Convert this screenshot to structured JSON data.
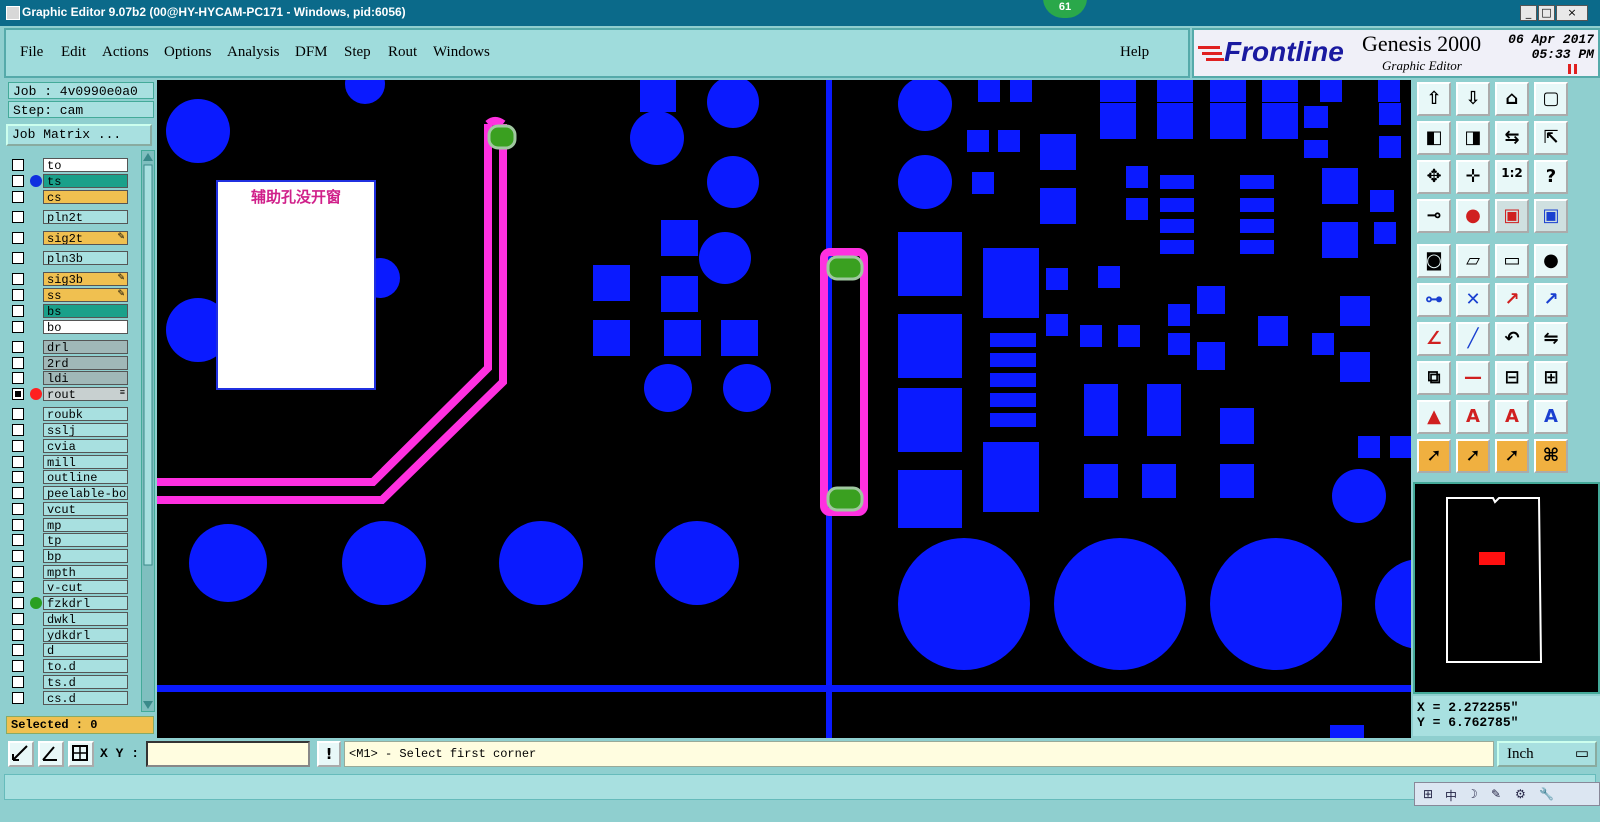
{
  "window": {
    "title": "Graphic Editor 9.07b2 (00@HY-HYCAM-PC171 - Windows, pid:6056)",
    "badge": "61",
    "controls": [
      "_",
      "□",
      "×"
    ]
  },
  "menu": {
    "items": [
      "File",
      "Edit",
      "Actions",
      "Options",
      "Analysis",
      "DFM",
      "Step",
      "Rout",
      "Windows"
    ],
    "help": "Help"
  },
  "brand": {
    "logo": "Frontline",
    "product": "Genesis 2000",
    "subtitle": "Graphic Editor",
    "date": "06 Apr 2017",
    "time": "05:33 PM"
  },
  "job": {
    "job_label": "Job : 4v0990e0a0",
    "step_label": "Step: cam",
    "matrix_button": "Job Matrix ..."
  },
  "layers": [
    {
      "name": "to",
      "bg": "#ffffff"
    },
    {
      "name": "ts",
      "bg": "#1aa08a",
      "dot": "#1030e0"
    },
    {
      "name": "cs",
      "bg": "#f0c050"
    },
    {
      "name": "pln2t",
      "bg": "#a8e0e0"
    },
    {
      "name": "sig2t",
      "bg": "#f0c050",
      "mark": "✎"
    },
    {
      "name": "pln3b",
      "bg": "#a8e0e0"
    },
    {
      "name": "sig3b",
      "bg": "#f0c050",
      "mark": "✎"
    },
    {
      "name": "ss",
      "bg": "#f0c050",
      "mark": "✎"
    },
    {
      "name": "bs",
      "bg": "#1aa08a"
    },
    {
      "name": "bo",
      "bg": "#ffffff"
    },
    {
      "name": "drl",
      "bg": "#a0b8b8"
    },
    {
      "name": "2rd",
      "bg": "#a0b8b8"
    },
    {
      "name": "ldi",
      "bg": "#a0b8b8"
    },
    {
      "name": "rout",
      "bg": "#c8d0d0",
      "dot": "#ff2020",
      "checked": true,
      "mark": "≡"
    },
    {
      "name": "roubk",
      "bg": "#a8e0e0"
    },
    {
      "name": "sslj",
      "bg": "#a8e0e0"
    },
    {
      "name": "cvia",
      "bg": "#a8e0e0"
    },
    {
      "name": "mill",
      "bg": "#a8e0e0"
    },
    {
      "name": "outline",
      "bg": "#a8e0e0"
    },
    {
      "name": "peelable-bot",
      "bg": "#a8e0e0"
    },
    {
      "name": "vcut",
      "bg": "#a8e0e0"
    },
    {
      "name": "mp",
      "bg": "#a8e0e0"
    },
    {
      "name": "tp",
      "bg": "#a8e0e0"
    },
    {
      "name": "bp",
      "bg": "#a8e0e0"
    },
    {
      "name": "mpth",
      "bg": "#a8e0e0"
    },
    {
      "name": "v-cut",
      "bg": "#a8e0e0"
    },
    {
      "name": "fzkdrl",
      "bg": "#a8e0e0",
      "dot": "#2aa020"
    },
    {
      "name": "dwkl",
      "bg": "#a8e0e0"
    },
    {
      "name": "ydkdrl",
      "bg": "#a8e0e0"
    },
    {
      "name": "d",
      "bg": "#a8e0e0"
    },
    {
      "name": "to.d",
      "bg": "#a8e0e0"
    },
    {
      "name": "ts.d",
      "bg": "#a8e0e0"
    },
    {
      "name": "cs.d",
      "bg": "#a8e0e0"
    }
  ],
  "selected": "Selected : 0",
  "canvas": {
    "note": "辅助孔没开窗",
    "colors": {
      "pad": "#0a1aff",
      "rout": "#ff30e0",
      "drill": "#3aa020",
      "background": "#000000"
    }
  },
  "tools": [
    "zoom-in-icon",
    "zoom-out-icon",
    "home-icon",
    "window-icon",
    "pan-left-icon",
    "pan-right-icon",
    "fit-icon",
    "resize-icon",
    "move-icon",
    "center-icon",
    "scale-1-2-icon",
    "help-icon",
    "measure-icon",
    "snap-icon",
    "layer-red-icon",
    "layer-blue-icon",
    "pad-icon",
    "polygon-icon",
    "ruler-icon",
    "circle-icon",
    "connect-icon",
    "cross-icon",
    "arrow-dot-icon",
    "arrow-red-icon",
    "line-angle-icon",
    "line-diag-icon",
    "undo-arc-icon",
    "mirror-icon",
    "copy-icon",
    "cut-icon",
    "stretch-icon",
    "group-icon",
    "triangle-red-icon",
    "triangle-a-icon",
    "triangle-b-icon",
    "triangle-c-icon",
    "pointer-icon",
    "pointer-box-icon",
    "pointer-select-icon",
    "pointer-chain-icon"
  ],
  "coords": {
    "x": "X = 2.272255\"",
    "y": "Y = 6.762785\""
  },
  "bottom": {
    "xy_label": "X Y :",
    "warn": "!",
    "prompt": "<M1> - Select first corner",
    "unit": "Inch"
  },
  "tray": [
    "中",
    "☽",
    "✎",
    "⚙",
    "🔧"
  ]
}
